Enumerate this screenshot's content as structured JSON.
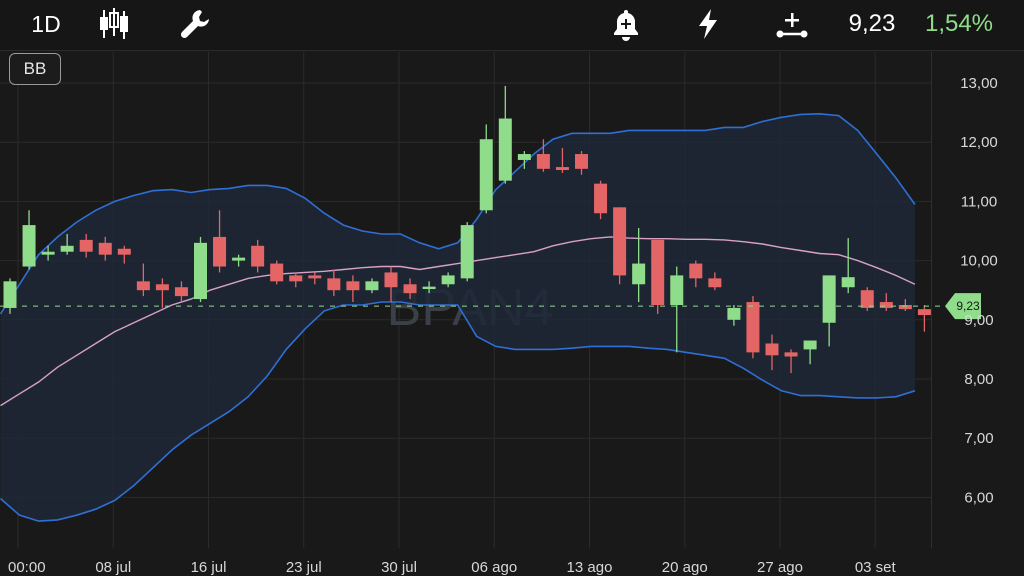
{
  "toolbar": {
    "timeframe": "1D",
    "price": "9,23",
    "change": "1,54%",
    "change_color": "#8fdc8a",
    "icons": [
      "candlestick-icon",
      "wrench-icon",
      "add-alert-bell-icon",
      "lightning-icon",
      "crosshair-plus-icon"
    ]
  },
  "indicator_button": {
    "label": "BB"
  },
  "colors": {
    "up": "#8fdc8a",
    "down": "#e46565",
    "band": "#2f6fd6",
    "band_fill": "#1e2838",
    "middle": "#d9a0c8",
    "last_price": "#8fdc8a"
  },
  "chart_data": {
    "type": "candlestick",
    "symbol_watermark": "BPAN4",
    "indicator": "Bollinger Bands",
    "ylim": [
      5.5,
      13.3
    ],
    "y_ticks": [
      "13,00",
      "12,00",
      "11,00",
      "10,00",
      "9,00",
      "8,00",
      "7,00",
      "6,00"
    ],
    "y_tick_values": [
      13,
      12,
      11,
      10,
      9,
      8,
      7,
      6
    ],
    "x_tick_labels": [
      "00:00",
      "08 jul",
      "16 jul",
      "23 jul",
      "30 jul",
      "06 ago",
      "13 ago",
      "20 ago",
      "27 ago",
      "03 set"
    ],
    "x_tick_index": [
      0,
      5,
      10,
      15,
      20,
      25,
      30,
      35,
      40,
      45
    ],
    "last_price": 9.23,
    "last_price_label": "9,23",
    "candles": [
      {
        "o": 9.2,
        "h": 9.7,
        "l": 9.1,
        "c": 9.65
      },
      {
        "o": 9.9,
        "h": 10.85,
        "l": 9.85,
        "c": 10.6
      },
      {
        "o": 10.1,
        "h": 10.25,
        "l": 10.0,
        "c": 10.15
      },
      {
        "o": 10.15,
        "h": 10.45,
        "l": 10.1,
        "c": 10.25
      },
      {
        "o": 10.35,
        "h": 10.45,
        "l": 10.05,
        "c": 10.15
      },
      {
        "o": 10.3,
        "h": 10.4,
        "l": 10.0,
        "c": 10.1
      },
      {
        "o": 10.2,
        "h": 10.25,
        "l": 9.95,
        "c": 10.1
      },
      {
        "o": 9.65,
        "h": 9.95,
        "l": 9.4,
        "c": 9.5
      },
      {
        "o": 9.6,
        "h": 9.7,
        "l": 9.2,
        "c": 9.5
      },
      {
        "o": 9.55,
        "h": 9.65,
        "l": 9.3,
        "c": 9.4
      },
      {
        "o": 9.35,
        "h": 10.4,
        "l": 9.3,
        "c": 10.3
      },
      {
        "o": 10.4,
        "h": 10.85,
        "l": 9.8,
        "c": 9.9
      },
      {
        "o": 10.0,
        "h": 10.1,
        "l": 9.9,
        "c": 10.05
      },
      {
        "o": 10.25,
        "h": 10.35,
        "l": 9.8,
        "c": 9.9
      },
      {
        "o": 9.95,
        "h": 10.0,
        "l": 9.6,
        "c": 9.65
      },
      {
        "o": 9.75,
        "h": 9.8,
        "l": 9.55,
        "c": 9.65
      },
      {
        "o": 9.75,
        "h": 9.8,
        "l": 9.6,
        "c": 9.7
      },
      {
        "o": 9.7,
        "h": 9.85,
        "l": 9.4,
        "c": 9.5
      },
      {
        "o": 9.65,
        "h": 9.75,
        "l": 9.3,
        "c": 9.5
      },
      {
        "o": 9.5,
        "h": 9.7,
        "l": 9.45,
        "c": 9.65
      },
      {
        "o": 9.8,
        "h": 9.9,
        "l": 9.3,
        "c": 9.55
      },
      {
        "o": 9.6,
        "h": 9.7,
        "l": 9.35,
        "c": 9.45
      },
      {
        "o": 9.52,
        "h": 9.65,
        "l": 9.45,
        "c": 9.56
      },
      {
        "o": 9.6,
        "h": 9.8,
        "l": 9.55,
        "c": 9.75
      },
      {
        "o": 9.7,
        "h": 10.65,
        "l": 9.65,
        "c": 10.6
      },
      {
        "o": 10.85,
        "h": 12.3,
        "l": 10.8,
        "c": 12.05
      },
      {
        "o": 11.35,
        "h": 12.95,
        "l": 11.3,
        "c": 12.4
      },
      {
        "o": 11.7,
        "h": 11.85,
        "l": 11.55,
        "c": 11.8
      },
      {
        "o": 11.8,
        "h": 12.05,
        "l": 11.5,
        "c": 11.55
      },
      {
        "o": 11.58,
        "h": 11.9,
        "l": 11.48,
        "c": 11.53
      },
      {
        "o": 11.8,
        "h": 11.85,
        "l": 11.45,
        "c": 11.55
      },
      {
        "o": 11.3,
        "h": 11.35,
        "l": 10.7,
        "c": 10.8
      },
      {
        "o": 10.9,
        "h": 10.9,
        "l": 9.6,
        "c": 9.75
      },
      {
        "o": 9.6,
        "h": 10.55,
        "l": 9.3,
        "c": 9.95
      },
      {
        "o": 10.35,
        "h": 10.35,
        "l": 9.1,
        "c": 9.25
      },
      {
        "o": 9.25,
        "h": 9.9,
        "l": 8.45,
        "c": 9.75
      },
      {
        "o": 9.95,
        "h": 10.0,
        "l": 9.55,
        "c": 9.7
      },
      {
        "o": 9.7,
        "h": 9.8,
        "l": 9.5,
        "c": 9.55
      },
      {
        "o": 9.0,
        "h": 9.25,
        "l": 8.9,
        "c": 9.2
      },
      {
        "o": 9.3,
        "h": 9.4,
        "l": 8.35,
        "c": 8.45
      },
      {
        "o": 8.6,
        "h": 8.75,
        "l": 8.15,
        "c": 8.4
      },
      {
        "o": 8.45,
        "h": 8.5,
        "l": 8.1,
        "c": 8.38
      },
      {
        "o": 8.5,
        "h": 8.65,
        "l": 8.25,
        "c": 8.65
      },
      {
        "o": 8.95,
        "h": 9.75,
        "l": 8.55,
        "c": 9.75
      },
      {
        "o": 9.55,
        "h": 10.38,
        "l": 9.45,
        "c": 9.72
      },
      {
        "o": 9.5,
        "h": 9.55,
        "l": 9.15,
        "c": 9.2
      },
      {
        "o": 9.3,
        "h": 9.45,
        "l": 9.15,
        "c": 9.2
      },
      {
        "o": 9.25,
        "h": 9.35,
        "l": 9.15,
        "c": 9.18
      },
      {
        "o": 9.18,
        "h": 9.25,
        "l": 8.8,
        "c": 9.08
      }
    ],
    "bands": {
      "upper": [
        9.1,
        9.6,
        10.1,
        10.4,
        10.65,
        10.85,
        11.0,
        11.1,
        11.18,
        11.2,
        11.15,
        11.2,
        11.22,
        11.27,
        11.27,
        11.22,
        11.05,
        10.8,
        10.6,
        10.5,
        10.45,
        10.45,
        10.3,
        10.2,
        10.3,
        10.7,
        11.2,
        11.5,
        11.8,
        12.05,
        12.15,
        12.15,
        12.15,
        12.2,
        12.2,
        12.2,
        12.2,
        12.2,
        12.25,
        12.25,
        12.35,
        12.42,
        12.47,
        12.48,
        12.45,
        12.2,
        11.8,
        11.4,
        10.95
      ],
      "middle": [
        7.55,
        7.75,
        7.95,
        8.2,
        8.4,
        8.6,
        8.8,
        8.95,
        9.1,
        9.25,
        9.35,
        9.5,
        9.6,
        9.7,
        9.75,
        9.78,
        9.8,
        9.82,
        9.85,
        9.88,
        9.9,
        9.9,
        9.85,
        9.9,
        9.95,
        10.0,
        10.05,
        10.1,
        10.15,
        10.25,
        10.32,
        10.37,
        10.4,
        10.38,
        10.37,
        10.37,
        10.36,
        10.36,
        10.35,
        10.32,
        10.28,
        10.22,
        10.17,
        10.12,
        10.1,
        10.0,
        9.88,
        9.75,
        9.6
      ],
      "lower": [
        5.98,
        5.7,
        5.6,
        5.62,
        5.7,
        5.8,
        5.95,
        6.2,
        6.5,
        6.8,
        7.05,
        7.25,
        7.45,
        7.7,
        8.05,
        8.5,
        8.85,
        9.15,
        9.25,
        9.25,
        9.3,
        9.3,
        9.25,
        9.25,
        9.25,
        8.72,
        8.55,
        8.5,
        8.5,
        8.5,
        8.52,
        8.55,
        8.55,
        8.55,
        8.52,
        8.5,
        8.45,
        8.4,
        8.35,
        8.18,
        7.98,
        7.8,
        7.72,
        7.72,
        7.7,
        7.68,
        7.68,
        7.7,
        7.8
      ]
    }
  }
}
